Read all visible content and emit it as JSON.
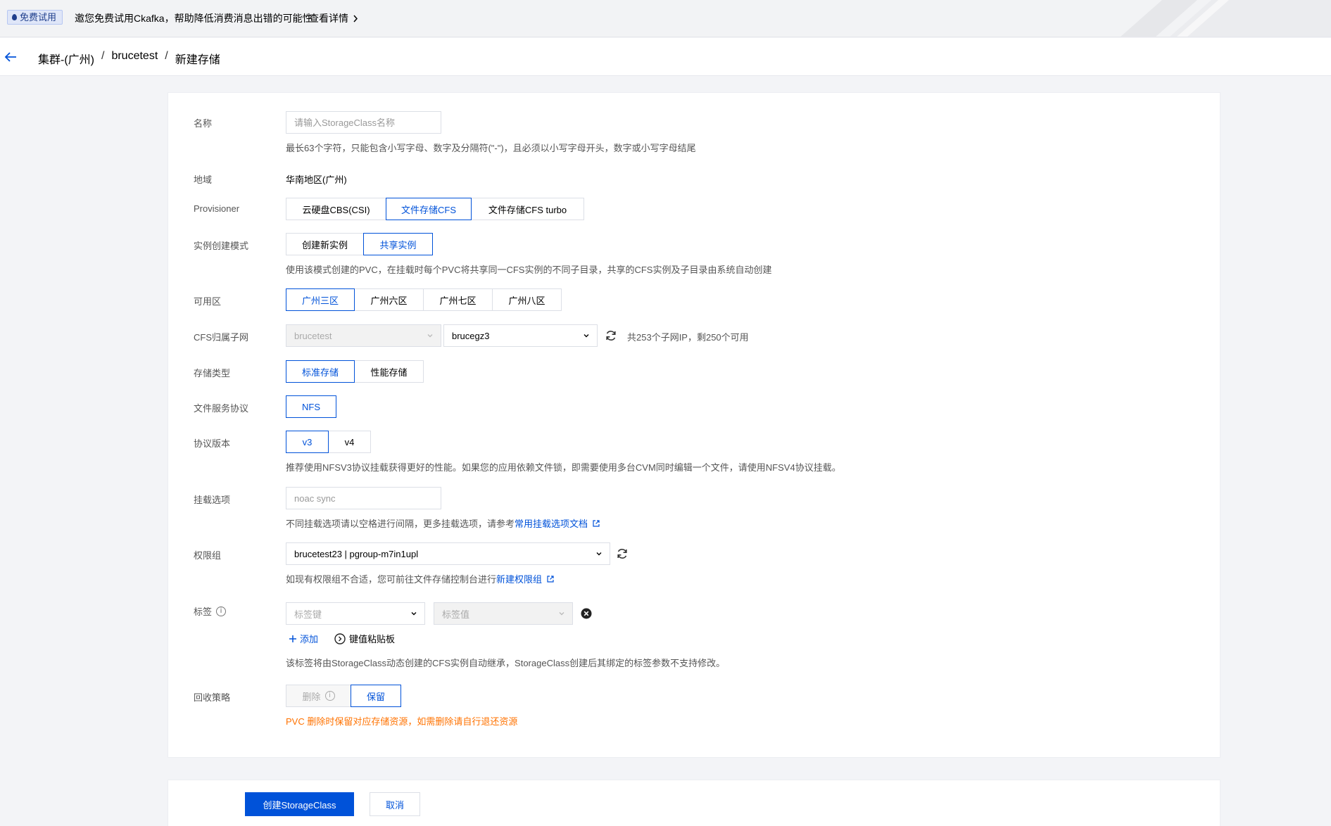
{
  "banner": {
    "tag": "免费试用",
    "text": "邀您免费试用Ckafka，帮助降低消费消息出错的可能性",
    "link": "查看详情"
  },
  "breadcrumb": [
    "集群-(广州)",
    "brucetest",
    "新建存储"
  ],
  "form": {
    "name": {
      "label": "名称",
      "placeholder": "请输入StorageClass名称",
      "hint": "最长63个字符，只能包含小写字母、数字及分隔符(\"-\")，且必须以小写字母开头，数字或小写字母结尾"
    },
    "region": {
      "label": "地域",
      "value": "华南地区(广州)"
    },
    "provisioner": {
      "label": "Provisioner",
      "options": [
        "云硬盘CBS(CSI)",
        "文件存储CFS",
        "文件存储CFS turbo"
      ],
      "selected": "文件存储CFS"
    },
    "instance_mode": {
      "label": "实例创建模式",
      "options": [
        "创建新实例",
        "共享实例"
      ],
      "selected": "共享实例",
      "hint": "使用该模式创建的PVC，在挂载时每个PVC将共享同一CFS实例的不同子目录，共享的CFS实例及子目录由系统自动创建"
    },
    "zone": {
      "label": "可用区",
      "options": [
        "广州三区",
        "广州六区",
        "广州七区",
        "广州八区"
      ],
      "selected": "广州三区"
    },
    "subnet": {
      "label": "CFS归属子网",
      "vpc": "brucetest",
      "subnet": "brucegz3",
      "info": "共253个子网IP，剩250个可用"
    },
    "storage_type": {
      "label": "存储类型",
      "options": [
        "标准存储",
        "性能存储"
      ],
      "selected": "标准存储"
    },
    "protocol": {
      "label": "文件服务协议",
      "options": [
        "NFS"
      ],
      "selected": "NFS"
    },
    "protocol_version": {
      "label": "协议版本",
      "options": [
        "v3",
        "v4"
      ],
      "selected": "v3",
      "hint": "推荐使用NFSV3协议挂载获得更好的性能。如果您的应用依赖文件锁，即需要使用多台CVM同时编辑一个文件，请使用NFSV4协议挂载。"
    },
    "mount_options": {
      "label": "挂载选项",
      "placeholder": "noac sync",
      "hint_prefix": "不同挂载选项请以空格进行间隔，更多挂载选项，请参考",
      "hint_link": "常用挂载选项文档"
    },
    "permission_group": {
      "label": "权限组",
      "value": "brucetest23 | pgroup-m7in1upl",
      "hint_prefix": "如现有权限组不合适，您可前往文件存储控制台进行",
      "hint_link": "新建权限组"
    },
    "tags": {
      "label": "标签",
      "key_placeholder": "标签键",
      "value_placeholder": "标签值",
      "add": "添加",
      "paste": "键值粘贴板",
      "hint": "该标签将由StorageClass动态创建的CFS实例自动继承，StorageClass创建后其绑定的标签参数不支持修改。"
    },
    "reclaim_policy": {
      "label": "回收策略",
      "options": [
        "删除",
        "保留"
      ],
      "selected": "保留",
      "warning": "PVC 删除时保留对应存储资源，如需删除请自行退还资源"
    }
  },
  "footer": {
    "submit": "创建StorageClass",
    "cancel": "取消"
  },
  "colors": {
    "primary": "#0052d9",
    "warning": "#ff7200",
    "page_bg": "#f3f4f7"
  }
}
